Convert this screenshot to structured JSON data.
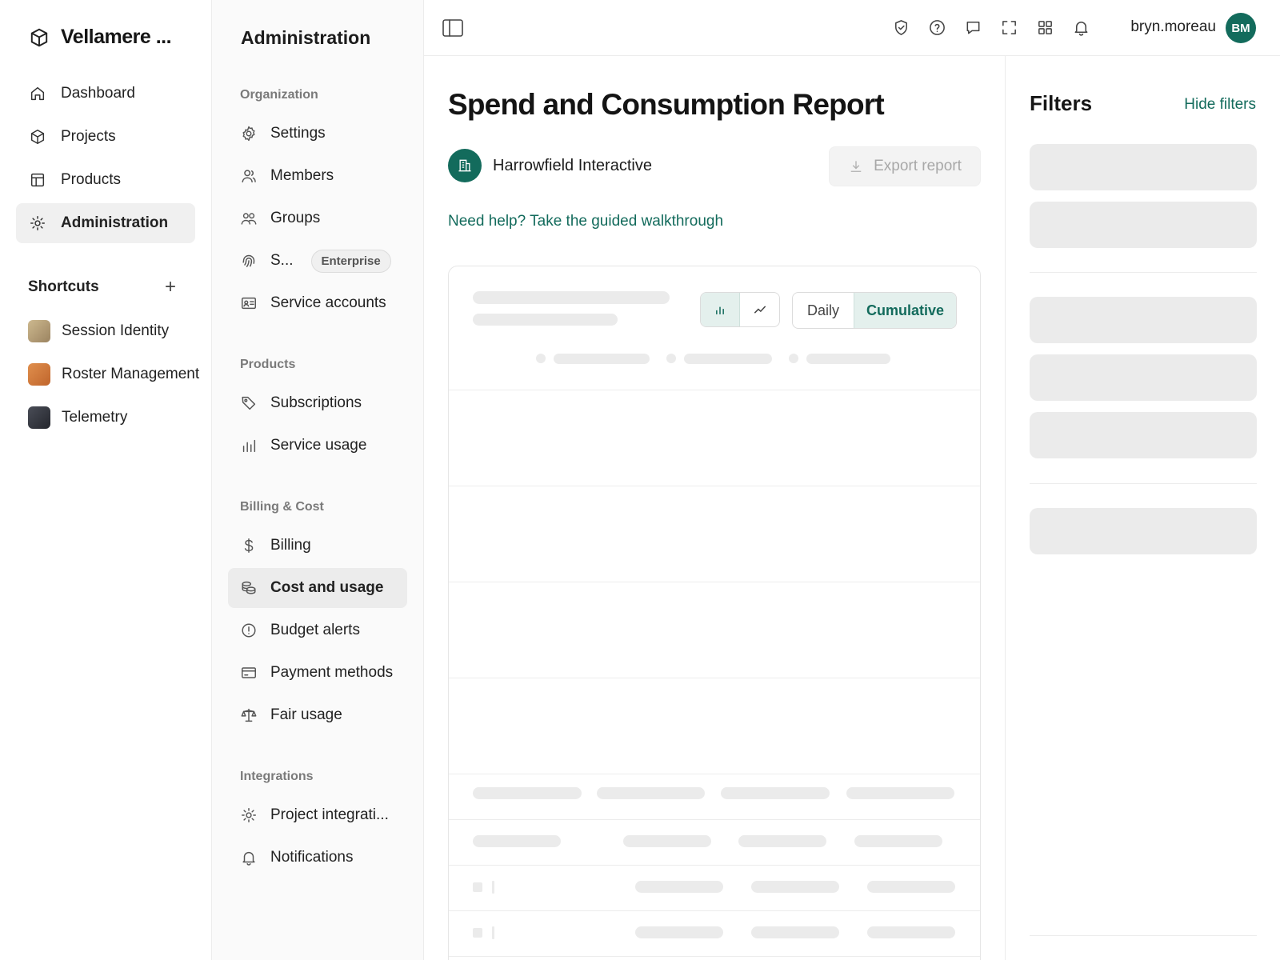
{
  "app": {
    "name": "Vellamere ..."
  },
  "sidebar": {
    "items": [
      {
        "label": "Dashboard",
        "icon": "home-icon"
      },
      {
        "label": "Projects",
        "icon": "cube-icon"
      },
      {
        "label": "Products",
        "icon": "layout-icon"
      },
      {
        "label": "Administration",
        "icon": "sun-gear-icon",
        "active": true
      }
    ],
    "shortcuts_label": "Shortcuts",
    "add_shortcut": "+",
    "shortcuts": [
      {
        "label": "Session Identity",
        "color": "#b29a73"
      },
      {
        "label": "Roster Management",
        "color": "#d17a3d"
      },
      {
        "label": "Telemetry",
        "color": "#3a3c44"
      }
    ]
  },
  "subnav": {
    "title": "Administration",
    "sections": [
      {
        "heading": "Organization",
        "items": [
          {
            "label": "Settings",
            "icon": "gear-icon"
          },
          {
            "label": "Members",
            "icon": "user-icon"
          },
          {
            "label": "Groups",
            "icon": "users-icon"
          },
          {
            "label": "S...",
            "icon": "fingerprint-icon",
            "badge": "Enterprise"
          },
          {
            "label": "Service accounts",
            "icon": "id-card-icon"
          }
        ]
      },
      {
        "heading": "Products",
        "items": [
          {
            "label": "Subscriptions",
            "icon": "tag-icon"
          },
          {
            "label": "Service usage",
            "icon": "bar-chart-icon"
          }
        ]
      },
      {
        "heading": "Billing & Cost",
        "items": [
          {
            "label": "Billing",
            "icon": "dollar-icon"
          },
          {
            "label": "Cost and usage",
            "icon": "coins-icon",
            "active": true
          },
          {
            "label": "Budget alerts",
            "icon": "alert-circle-icon"
          },
          {
            "label": "Payment methods",
            "icon": "credit-card-icon"
          },
          {
            "label": "Fair usage",
            "icon": "scale-icon"
          }
        ]
      },
      {
        "heading": "Integrations",
        "items": [
          {
            "label": "Project integrati...",
            "icon": "sun-icon"
          },
          {
            "label": "Notifications",
            "icon": "bell-icon"
          }
        ]
      }
    ]
  },
  "topbar": {
    "icons": [
      "shield-check-icon",
      "help-icon",
      "chat-icon",
      "fullscreen-icon",
      "apps-grid-icon",
      "bell-icon"
    ],
    "username": "bryn.moreau",
    "avatar_initials": "BM",
    "accent": "#136b5c"
  },
  "main": {
    "title": "Spend and Consumption Report",
    "org_name": "Harrowfield Interactive",
    "export_label": "Export report",
    "help_link": "Need help? Take the guided walkthrough",
    "chart_toggle": {
      "bar": "bar-chart-icon",
      "line": "line-chart-icon",
      "selected": "bar"
    },
    "range_toggle": {
      "options": [
        "Daily",
        "Cumulative"
      ],
      "selected": "Cumulative"
    }
  },
  "filters": {
    "title": "Filters",
    "hide_label": "Hide filters"
  }
}
